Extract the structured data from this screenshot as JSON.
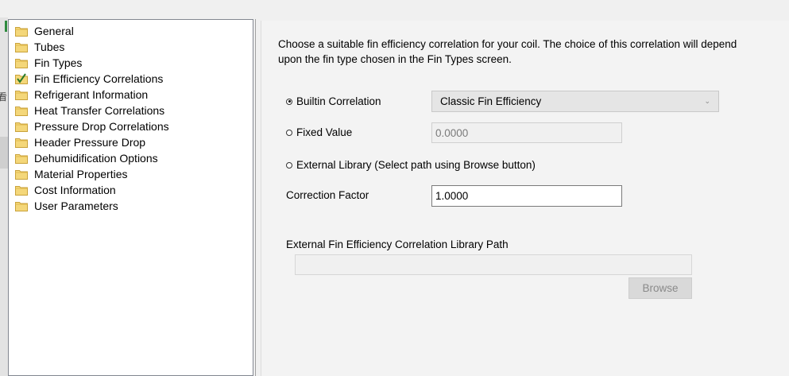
{
  "left_strip": {
    "glyph": "看"
  },
  "tree": {
    "items": [
      {
        "label": "General",
        "state": "normal"
      },
      {
        "label": "Tubes",
        "state": "normal"
      },
      {
        "label": "Fin Types",
        "state": "normal"
      },
      {
        "label": "Fin Efficiency Correlations",
        "state": "checked"
      },
      {
        "label": "Refrigerant Information",
        "state": "normal"
      },
      {
        "label": "Heat Transfer Correlations",
        "state": "normal"
      },
      {
        "label": "Pressure Drop Correlations",
        "state": "normal"
      },
      {
        "label": "Header Pressure Drop",
        "state": "normal"
      },
      {
        "label": "Dehumidification Options",
        "state": "normal"
      },
      {
        "label": "Material Properties",
        "state": "normal"
      },
      {
        "label": "Cost Information",
        "state": "normal"
      },
      {
        "label": "User Parameters",
        "state": "normal"
      }
    ]
  },
  "panel": {
    "description_line1": "Choose a suitable fin efficiency correlation for your coil. The choice of this correlation will depend",
    "description_line2": "upon the fin type chosen in the Fin Types screen.",
    "builtin_label": "Builtin Correlation",
    "builtin_selected": true,
    "builtin_value": "Classic Fin Efficiency",
    "fixed_label": "Fixed Value",
    "fixed_value": "0.0000",
    "external_label": "External Library (Select path using Browse button)",
    "correction_label": "Correction Factor",
    "correction_value": "1.0000",
    "path_label": "External Fin Efficiency Correlation Library Path",
    "path_value": "",
    "browse_label": "Browse"
  },
  "colors": {
    "folder": "#e8c04a",
    "check": "#2a7a2a",
    "tree_bg": "#ffffff",
    "panel_bg": "#f3f3f3"
  }
}
